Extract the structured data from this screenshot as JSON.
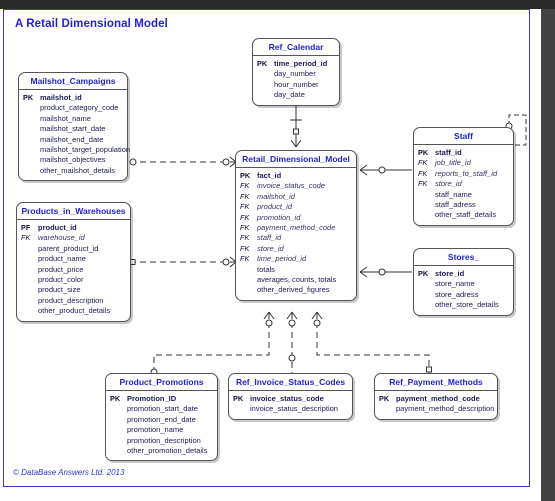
{
  "page": {
    "title": "A Retail Dimensional Model",
    "copyright": "© DataBase Answers Ltd. 2013",
    "accent_color": "#2222dd",
    "entity_border_color": "#555555",
    "canvas_border_color": "#3b3bb5"
  },
  "entities": {
    "mailshot_campaigns": {
      "name": "Mailshot_Campaigns",
      "attributes": [
        {
          "key": "PK",
          "name": "mailshot_id"
        },
        {
          "key": "",
          "name": "product_category_code"
        },
        {
          "key": "",
          "name": "mailshot_name"
        },
        {
          "key": "",
          "name": "mailshot_start_date"
        },
        {
          "key": "",
          "name": "mailshot_end_date"
        },
        {
          "key": "",
          "name": "mailshot_target_population"
        },
        {
          "key": "",
          "name": "mailshot_objectives"
        },
        {
          "key": "",
          "name": "other_mailshot_details"
        }
      ]
    },
    "products_in_warehouses": {
      "name": "Products_in_Warehouses",
      "attributes": [
        {
          "key": "PF",
          "name": "product_id"
        },
        {
          "key": "FK",
          "name": "warehouse_id"
        },
        {
          "key": "",
          "name": "parent_product_id"
        },
        {
          "key": "",
          "name": "product_name"
        },
        {
          "key": "",
          "name": "product_price"
        },
        {
          "key": "",
          "name": "product_color"
        },
        {
          "key": "",
          "name": "product_size"
        },
        {
          "key": "",
          "name": "product_description"
        },
        {
          "key": "",
          "name": "other_product_details"
        }
      ]
    },
    "ref_calendar": {
      "name": "Ref_Calendar",
      "attributes": [
        {
          "key": "PK",
          "name": "time_period_id"
        },
        {
          "key": "",
          "name": "day_number"
        },
        {
          "key": "",
          "name": "hour_number"
        },
        {
          "key": "",
          "name": "day_date"
        }
      ]
    },
    "retail_dimensional_model": {
      "name": "Retail_Dimensional_Model",
      "attributes": [
        {
          "key": "PK",
          "name": "fact_id"
        },
        {
          "key": "FK",
          "name": "invoice_status_code"
        },
        {
          "key": "FK",
          "name": "mailshot_id"
        },
        {
          "key": "FK",
          "name": "product_id"
        },
        {
          "key": "FK",
          "name": "promotion_id"
        },
        {
          "key": "FK",
          "name": "payment_method_code"
        },
        {
          "key": "FK",
          "name": "staff_id"
        },
        {
          "key": "FK",
          "name": "store_id"
        },
        {
          "key": "FK",
          "name": "time_period_id"
        },
        {
          "key": "",
          "name": "totals"
        },
        {
          "key": "",
          "name": "averages, counts, totals"
        },
        {
          "key": "",
          "name": "other_derived_figures"
        }
      ]
    },
    "staff": {
      "name": "Staff",
      "attributes": [
        {
          "key": "PK",
          "name": "staff_id"
        },
        {
          "key": "FK",
          "name": "job_title_id"
        },
        {
          "key": "FK",
          "name": "reports_to_staff_id"
        },
        {
          "key": "FK",
          "name": "store_id"
        },
        {
          "key": "",
          "name": "staff_name"
        },
        {
          "key": "",
          "name": "staff_adress"
        },
        {
          "key": "",
          "name": "other_staff_details"
        }
      ]
    },
    "stores": {
      "name": "Stores_",
      "attributes": [
        {
          "key": "PK",
          "name": "store_id"
        },
        {
          "key": "",
          "name": "store_name"
        },
        {
          "key": "",
          "name": "store_adress"
        },
        {
          "key": "",
          "name": "other_store_details"
        }
      ]
    },
    "product_promotions": {
      "name": "Product_Promotions",
      "attributes": [
        {
          "key": "PK",
          "name": "Promotion_ID"
        },
        {
          "key": "",
          "name": "promotion_start_date"
        },
        {
          "key": "",
          "name": "promotion_end_date"
        },
        {
          "key": "",
          "name": "promotion_name"
        },
        {
          "key": "",
          "name": "promotion_description"
        },
        {
          "key": "",
          "name": "other_promotion_details"
        }
      ]
    },
    "ref_invoice_status_codes": {
      "name": "Ref_Invoice_Status_Codes",
      "attributes": [
        {
          "key": "PK",
          "name": "invoice_status_code"
        },
        {
          "key": "",
          "name": "invoice_status_description"
        }
      ]
    },
    "ref_payment_methods": {
      "name": "Ref_Payment_Methods",
      "attributes": [
        {
          "key": "PK",
          "name": "payment_method_code"
        },
        {
          "key": "",
          "name": "payment_method_description"
        }
      ]
    }
  },
  "relationships": [
    {
      "from": "mailshot_campaigns",
      "to": "retail_dimensional_model",
      "style": "dashed",
      "from_card": "zero-one",
      "to_card": "zero-many"
    },
    {
      "from": "products_in_warehouses",
      "to": "retail_dimensional_model",
      "style": "dashed",
      "from_card": "zero-one",
      "to_card": "zero-many"
    },
    {
      "from": "ref_calendar",
      "to": "retail_dimensional_model",
      "style": "solid",
      "from_card": "one",
      "to_card": "zero-many"
    },
    {
      "from": "retail_dimensional_model",
      "to": "staff",
      "style": "solid",
      "from_card": "zero-many",
      "to_card": "zero-one"
    },
    {
      "from": "retail_dimensional_model",
      "to": "stores",
      "style": "solid",
      "from_card": "zero-many",
      "to_card": "zero-one"
    },
    {
      "from": "retail_dimensional_model",
      "to": "product_promotions",
      "style": "dashed",
      "from_card": "zero-many",
      "to_card": "zero-one"
    },
    {
      "from": "retail_dimensional_model",
      "to": "ref_invoice_status_codes",
      "style": "dashed",
      "from_card": "zero-many",
      "to_card": "zero-one"
    },
    {
      "from": "retail_dimensional_model",
      "to": "ref_payment_methods",
      "style": "dashed",
      "from_card": "zero-many",
      "to_card": "zero-one"
    },
    {
      "from": "staff",
      "to": "staff",
      "style": "solid",
      "from_card": "zero-one",
      "to_card": "zero-many",
      "note": "reports_to self reference"
    }
  ]
}
